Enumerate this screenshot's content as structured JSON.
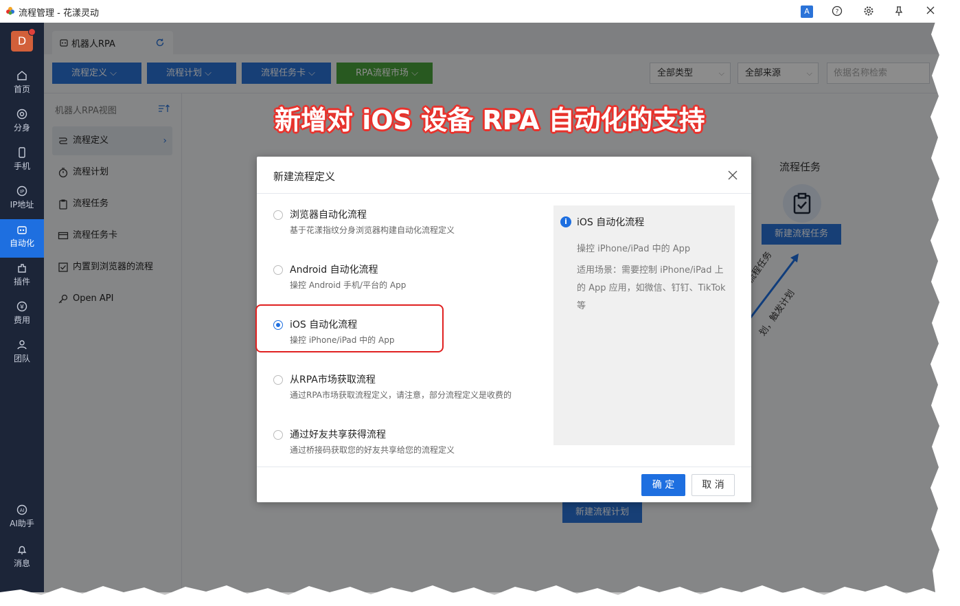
{
  "window": {
    "title": "流程管理 - 花漾灵动"
  },
  "titlebar_icons": [
    "translate-icon",
    "help-icon",
    "settings-icon",
    "pin-icon",
    "close-icon"
  ],
  "avatar": {
    "letter": "D"
  },
  "nav": [
    {
      "label": "首页",
      "icon": "home-icon"
    },
    {
      "label": "分身",
      "icon": "browser-icon"
    },
    {
      "label": "手机",
      "icon": "phone-icon"
    },
    {
      "label": "IP地址",
      "icon": "ip-icon"
    },
    {
      "label": "自动化",
      "icon": "robot-icon",
      "active": true
    },
    {
      "label": "插件",
      "icon": "plugin-icon"
    },
    {
      "label": "费用",
      "icon": "yen-icon"
    },
    {
      "label": "团队",
      "icon": "team-icon"
    },
    {
      "label": "AI助手",
      "icon": "ai-icon"
    },
    {
      "label": "消息",
      "icon": "bell-icon"
    }
  ],
  "tab": {
    "label": "机器人RPA"
  },
  "toolbar": {
    "buttons": [
      "流程定义",
      "流程计划",
      "流程任务卡",
      "RPA流程市场"
    ],
    "filter_type": "全部类型",
    "filter_source": "全部来源",
    "search_placeholder": "依据名称检索"
  },
  "sidepanel": {
    "title": "机器人RPA视图",
    "items": [
      "流程定义",
      "流程计划",
      "流程任务",
      "流程任务卡",
      "内置到浏览器的流程",
      "Open API"
    ]
  },
  "background": {
    "task_title": "流程任务",
    "new_task_btn": "新建流程任务",
    "new_plan_btn": "新建流程计划",
    "diag_text_1": "流程任务",
    "diag_text_2": "划，触发计划"
  },
  "headline": "新增对 iOS 设备 RPA 自动化的支持",
  "dialog": {
    "title": "新建流程定义",
    "options": [
      {
        "title": "浏览器自动化流程",
        "desc": "基于花漾指纹分身浏览器构建自动化流程定义",
        "selected": false
      },
      {
        "title": "Android 自动化流程",
        "desc": "操控 Android 手机/平台的 App",
        "selected": false
      },
      {
        "title": "iOS 自动化流程",
        "desc": "操控 iPhone/iPad 中的 App",
        "selected": true
      },
      {
        "title": "从RPA市场获取流程",
        "desc": "通过RPA市场获取流程定义，请注意，部分流程定义是收费的",
        "selected": false
      },
      {
        "title": "通过好友共享获得流程",
        "desc": "通过桥接码获取您的好友共享给您的流程定义",
        "selected": false
      }
    ],
    "info": {
      "title": "iOS 自动化流程",
      "desc": "操控 iPhone/iPad 中的 App",
      "scene": "适用场景：需要控制 iPhone/iPad 上的 App 应用，如微信、钉钉、TikTok 等"
    },
    "ok": "确 定",
    "cancel": "取 消"
  },
  "colors": {
    "accent": "#1e6fe0",
    "nav_bg": "#1c2538",
    "market_green": "#49a33b",
    "highlight_red": "#e02020"
  }
}
